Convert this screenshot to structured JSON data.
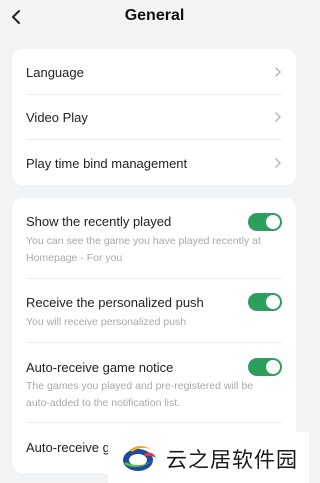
{
  "header": {
    "title": "General"
  },
  "settings_links": [
    {
      "label": "Language"
    },
    {
      "label": "Video Play"
    },
    {
      "label": "Play time bind management"
    }
  ],
  "toggles": [
    {
      "label": "Show the recently played",
      "description": "You can see the game you have played recently at Homepage - For you",
      "enabled": true
    },
    {
      "label": "Receive the personalized push",
      "description": "You will receive personalized push",
      "enabled": true
    },
    {
      "label": "Auto-receive game notice",
      "description": "The games you played and pre-registered will be auto-added to the notification list.",
      "enabled": true
    },
    {
      "label": "Auto-receive g"
    }
  ],
  "watermark": {
    "text": "云之居软件园"
  },
  "colors": {
    "background": "#f2f3f5",
    "toggle_on": "#2e9e5e",
    "card": "#ffffff"
  }
}
